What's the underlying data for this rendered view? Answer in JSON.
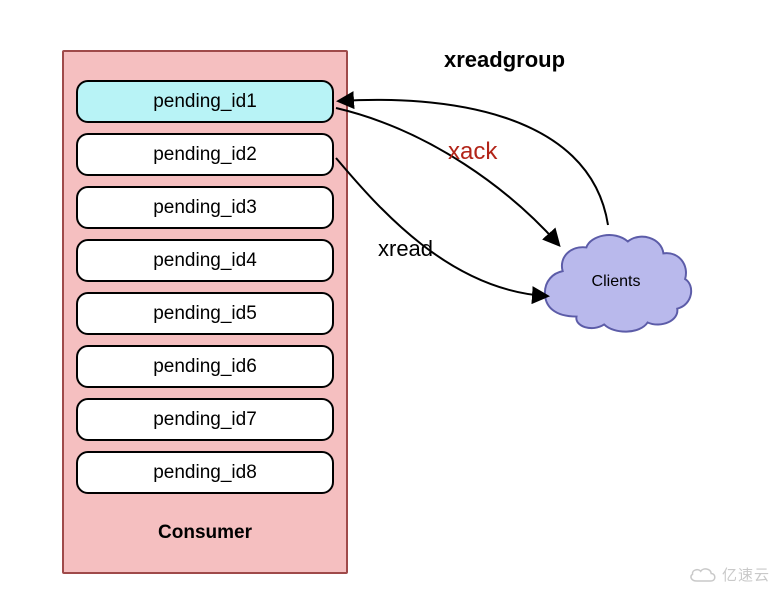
{
  "consumer": {
    "label": "Consumer",
    "items": [
      {
        "label": "pending_id1",
        "highlighted": true
      },
      {
        "label": "pending_id2",
        "highlighted": false
      },
      {
        "label": "pending_id3",
        "highlighted": false
      },
      {
        "label": "pending_id4",
        "highlighted": false
      },
      {
        "label": "pending_id5",
        "highlighted": false
      },
      {
        "label": "pending_id6",
        "highlighted": false
      },
      {
        "label": "pending_id7",
        "highlighted": false
      },
      {
        "label": "pending_id8",
        "highlighted": false
      }
    ]
  },
  "clients": {
    "label": "Clients"
  },
  "arrows": {
    "xreadgroup": {
      "label": "xreadgroup",
      "color": "#000000"
    },
    "xack": {
      "label": "xack",
      "color": "#b22418"
    },
    "xread": {
      "label": "xread",
      "color": "#000000"
    }
  },
  "watermark": {
    "text": "亿速云"
  }
}
